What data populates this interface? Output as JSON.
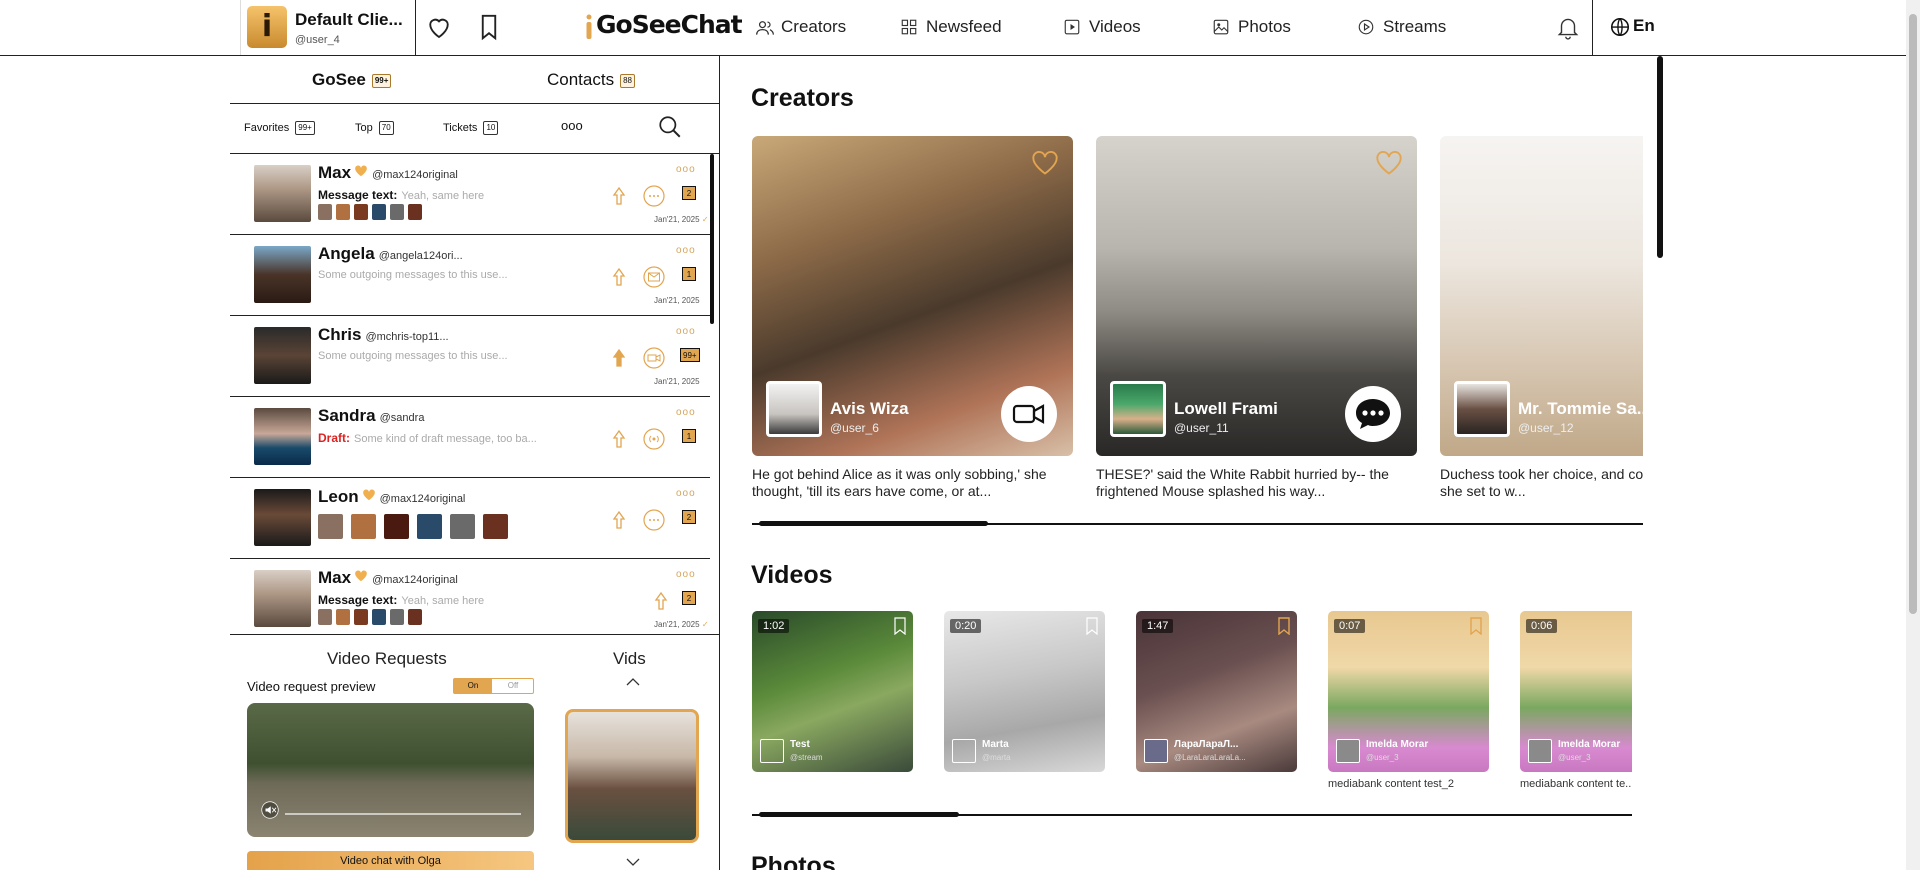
{
  "user": {
    "avatar_letter": "i",
    "name": "Default Clie...",
    "handle": "@user_4"
  },
  "brand": {
    "logo": "GoSeeChat",
    "accent": "#e2a550"
  },
  "nav": [
    {
      "label": "Creators",
      "icon": "users-icon"
    },
    {
      "label": "Newsfeed",
      "icon": "grid-icon"
    },
    {
      "label": "Videos",
      "icon": "play-icon"
    },
    {
      "label": "Photos",
      "icon": "image-icon"
    },
    {
      "label": "Streams",
      "icon": "stream-icon"
    }
  ],
  "language": "En",
  "sidebar": {
    "tabs": [
      {
        "label": "GoSee",
        "badge": "99+"
      },
      {
        "label": "Contacts",
        "badge": "88"
      }
    ],
    "filters": [
      {
        "label": "Favorites",
        "badge": "99+"
      },
      {
        "label": "Top",
        "badge": "70"
      },
      {
        "label": "Tickets",
        "badge": "10"
      }
    ],
    "more": "ooo",
    "chats": [
      {
        "name": "Max",
        "handle": "@max124original",
        "msg_label": "Message text:",
        "msg": "Yeah, same here",
        "count": "2",
        "date": "Jan'21, 2025",
        "tick": "✓",
        "dots": "ooo"
      },
      {
        "name": "Angela",
        "handle": "@angela124ori...",
        "msg_label": "",
        "msg": "Some outgoing messages to this use...",
        "count": "1",
        "date": "Jan'21, 2025",
        "tick": "",
        "dots": "ooo"
      },
      {
        "name": "Chris",
        "handle": "@mchris-top11...",
        "msg_label": "",
        "msg": "Some outgoing messages to this use...",
        "count": "99+",
        "date": "Jan'21, 2025",
        "tick": "",
        "dots": "ooo"
      },
      {
        "name": "Sandra",
        "handle": "@sandra",
        "msg_label": "Draft:",
        "msg": "Some kind of draft message, too ba...",
        "count": "1",
        "date": "",
        "tick": "",
        "dots": "ooo"
      },
      {
        "name": "Leon",
        "handle": "@max124original",
        "msg_label": "",
        "msg": "",
        "count": "2",
        "date": "",
        "tick": "",
        "dots": "ooo"
      },
      {
        "name": "Max",
        "handle": "@max124original",
        "msg_label": "Message text:",
        "msg": "Yeah, same here",
        "count": "2",
        "date": "Jan'21, 2025",
        "tick": "✓",
        "dots": "ooo"
      }
    ],
    "video_requests": {
      "title": "Video Requests",
      "vids_title": "Vids",
      "preview_label": "Video request preview",
      "toggle_on": "On",
      "toggle_off": "Off",
      "cta": "Video chat with Olga"
    }
  },
  "creators": {
    "title": "Creators",
    "items": [
      {
        "name": "Avis Wiza",
        "handle": "@user_6",
        "desc": "He got behind Alice as it was only sobbing,' she thought, 'till its ears have come, or at...",
        "action": "video-call-icon"
      },
      {
        "name": "Lowell Frami",
        "handle": "@user_11",
        "desc": "THESE?' said the White Rabbit hurried by-- the frightened Mouse splashed his way...",
        "action": "chat-bubble-icon"
      },
      {
        "name": "Mr. Tommie Sa...",
        "handle": "@user_12",
        "desc": "Duchess took her choice, and common way. So she set to w...",
        "action": ""
      }
    ]
  },
  "videos": {
    "title": "Videos",
    "items": [
      {
        "duration": "1:02",
        "user": "Test",
        "handle": "@stream",
        "caption": ""
      },
      {
        "duration": "0:20",
        "user": "Marta",
        "handle": "@marta",
        "caption": ""
      },
      {
        "duration": "1:47",
        "user": "ЛараЛараЛ...",
        "handle": "@LaraLaraLaraLa...",
        "caption": ""
      },
      {
        "duration": "0:07",
        "user": "Imelda Morar",
        "handle": "@user_3",
        "caption": "mediabank content test_2"
      },
      {
        "duration": "0:06",
        "user": "Imelda Morar",
        "handle": "@user_3",
        "caption": "mediabank content te..."
      }
    ]
  },
  "photos": {
    "title": "Photos"
  }
}
